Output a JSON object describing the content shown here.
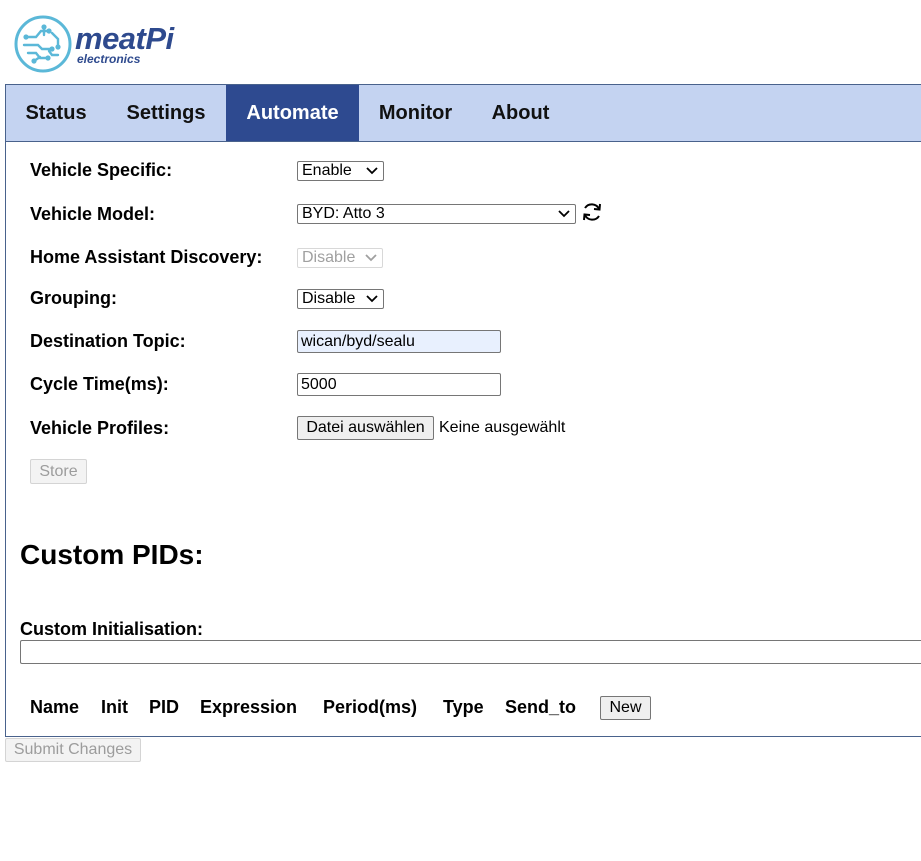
{
  "logo": {
    "name": "meatPi",
    "sub": "electronics",
    "color": "#2e4a8e",
    "accent": "#5bb8d8"
  },
  "tabs": [
    {
      "label": "Status",
      "active": false
    },
    {
      "label": "Settings",
      "active": false
    },
    {
      "label": "Automate",
      "active": true
    },
    {
      "label": "Monitor",
      "active": false
    },
    {
      "label": "About",
      "active": false
    }
  ],
  "form": {
    "vehicle_specific": {
      "label": "Vehicle Specific:",
      "value": "Enable"
    },
    "vehicle_model": {
      "label": "Vehicle Model:",
      "value": "BYD: Atto 3",
      "refresh_icon": "refresh-icon"
    },
    "ha_discovery": {
      "label": "Home Assistant Discovery:",
      "value": "Disable",
      "disabled": true
    },
    "grouping": {
      "label": "Grouping:",
      "value": "Disable"
    },
    "destination_topic": {
      "label": "Destination Topic:",
      "value": "wican/byd/sealu"
    },
    "cycle_time": {
      "label": "Cycle Time(ms):",
      "value": "5000"
    },
    "vehicle_profiles": {
      "label": "Vehicle Profiles:",
      "button": "Datei auswählen",
      "status": "Keine ausgewählt"
    },
    "store_button": "Store"
  },
  "custom_pids": {
    "heading": "Custom PIDs:",
    "init_label": "Custom Initialisation:",
    "init_value": "",
    "columns": [
      "Name",
      "Init",
      "PID",
      "Expression",
      "Period(ms)",
      "Type",
      "Send_to"
    ],
    "new_button": "New"
  },
  "submit_button": "Submit Changes",
  "colors": {
    "tab_bg": "#c4d3f1",
    "tab_active": "#2e4a90",
    "frame_border": "#49628c"
  }
}
